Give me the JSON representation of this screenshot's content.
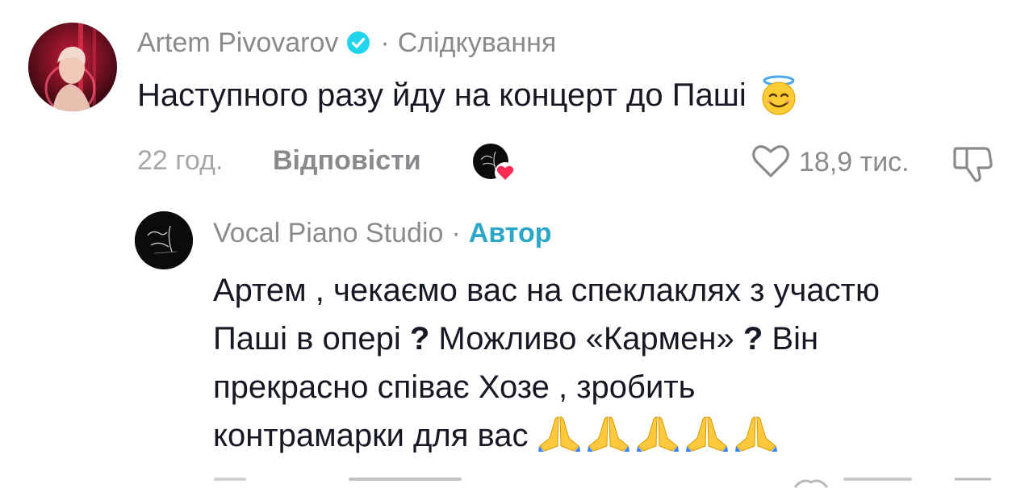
{
  "comment": {
    "author": "Artem Pivovarov",
    "separator": "·",
    "status": "Слідкування",
    "text": "Наступного разу йду на концерт до Паші",
    "time": "22 год.",
    "reply_label": "Відповісти",
    "likes": "18,9 тис.",
    "icons": {
      "verified": "verified-badge-icon",
      "emoji": "smiling-face-with-halo-emoji",
      "heart": "heart-outline-icon",
      "dislike": "thumbs-down-icon",
      "creator_liked": "creator-liked-avatar"
    }
  },
  "reply": {
    "author": "Vocal Piano Studio",
    "separator": "·",
    "tag": "Автор",
    "lines": [
      "Артем , чекаємо вас на спеклаклях з участю",
      "Паші в опері",
      "Можливо «Кармен»",
      "Він",
      "прекрасно співає Хозе , зробить",
      "контрамарки для вас"
    ],
    "question_mark": "?",
    "emoji": "folded-hands-emoji",
    "emoji_count": 5
  },
  "colors": {
    "text": "#161823",
    "secondary": "#8a8a8e",
    "muted": "#a7a7ab",
    "author_tag": "#2aa6c9",
    "verified": "#20d5ec",
    "heart_red": "#fe2c55"
  }
}
